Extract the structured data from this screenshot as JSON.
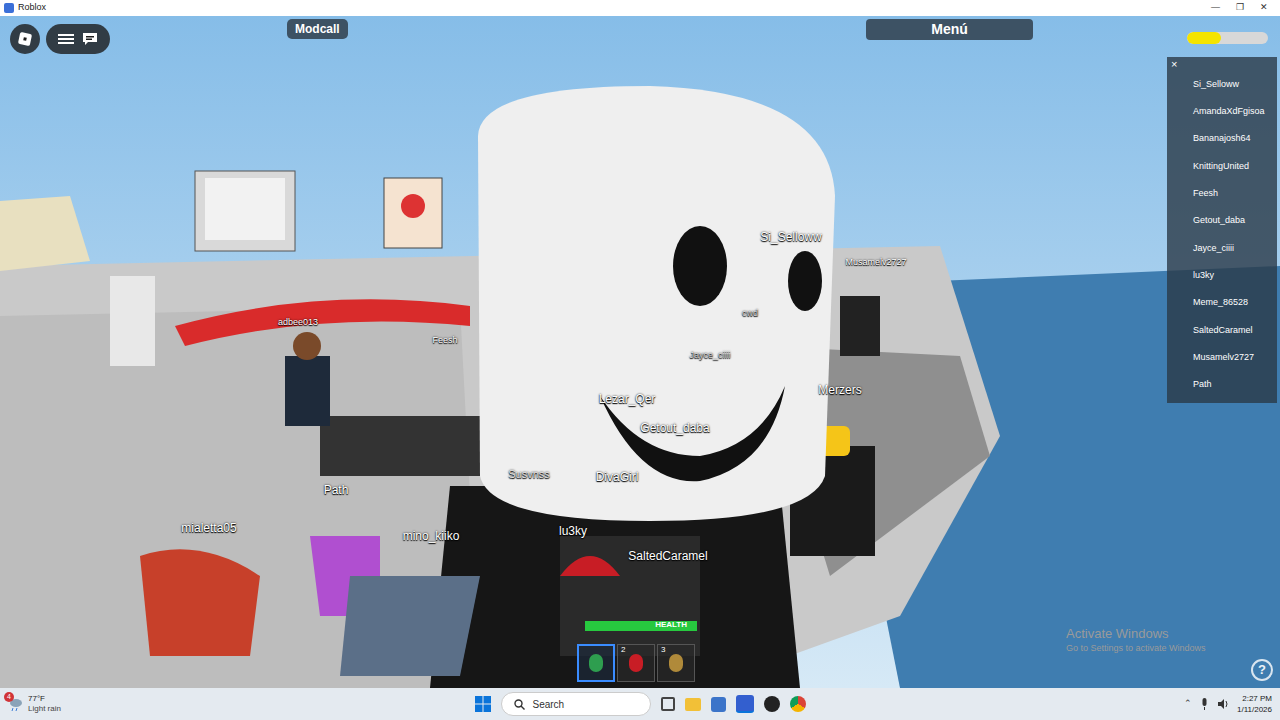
{
  "window": {
    "title": "Roblox",
    "controls": [
      "—",
      "❐",
      "✕"
    ]
  },
  "top_bar": {
    "modcall": "Modcall",
    "menu": "Menú",
    "meter_level": 0.42
  },
  "player_list": {
    "close": "×",
    "players": [
      "Si_Selloww",
      "AmandaXdFgisoa",
      "Bananajosh64",
      "KnittingUnited",
      "Feesh",
      "Getout_daba",
      "Jayce_ciiii",
      "lu3ky",
      "Meme_86528",
      "SaltedCaramel",
      "Musamelv2727",
      "Path"
    ]
  },
  "name_tags": [
    "Si_Selloww",
    "Musamelv2727",
    "Merzers",
    "Lezar_Qer",
    "Getout_daba",
    "Jayce_ciiii",
    "cwd",
    "DivaGirl",
    "Susvnss",
    "lu3ky",
    "SaltedCaramel",
    "mialetta05",
    "Path",
    "mino_kiiko",
    "adbee013",
    "Feesh"
  ],
  "hotbar": {
    "health_label": "HEALTH",
    "health_level": 1,
    "slots": [
      {
        "selected": true
      },
      {
        "number": "2",
        "selected": false
      },
      {
        "number": "3",
        "selected": false
      }
    ]
  },
  "watermark": {
    "title": "Activate Windows",
    "subtitle": "Go to Settings to activate Windows"
  },
  "help": "?",
  "taskbar": {
    "badge": "4",
    "temperature": "77°F",
    "weather": "Light rain",
    "search": "Search",
    "time": "2:27 PM",
    "date": "1/11/2026"
  }
}
